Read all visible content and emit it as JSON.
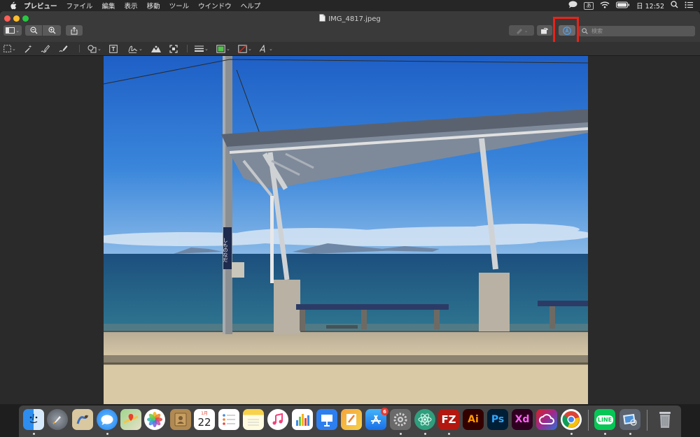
{
  "menubar": {
    "app": "プレビュー",
    "items": [
      "ファイル",
      "編集",
      "表示",
      "移動",
      "ツール",
      "ウインドウ",
      "ヘルプ"
    ],
    "ime_label": "あ",
    "clock": "日 12:52"
  },
  "window": {
    "title": "IMG_4817.jpeg",
    "search_placeholder": "検索"
  },
  "photo": {
    "sign_text": "しものなだ"
  },
  "dock": {
    "calendar_month": "1月",
    "calendar_day": "22",
    "appstore_badge": "6",
    "filezilla_label": "FZ",
    "illustrator_label": "Ai",
    "photoshop_label": "Ps",
    "xd_label": "Xd",
    "line_label": "LINE"
  },
  "colors": {
    "highlight": "#e8231a",
    "accent": "#3d8de0",
    "sky": "#2f74cf",
    "sea": "#1f5a86"
  }
}
